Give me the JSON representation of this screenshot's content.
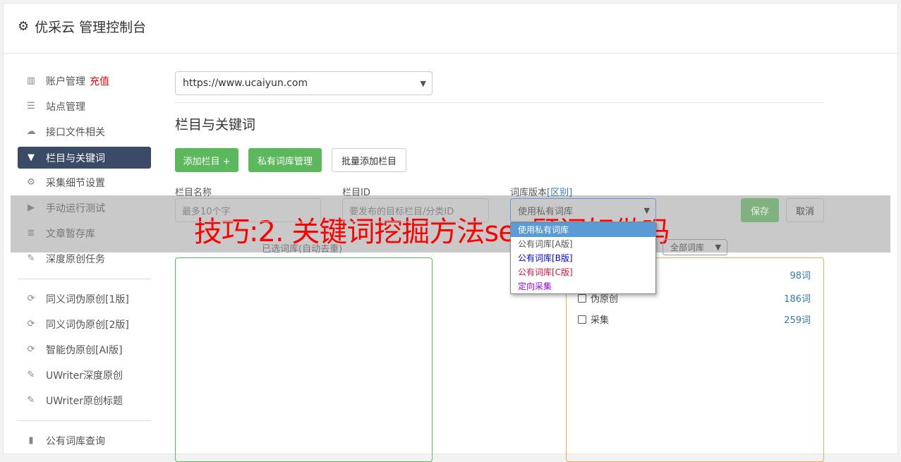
{
  "header": {
    "title": "优采云 管理控制台",
    "icon": "gear-icon"
  },
  "sidebar": {
    "items": [
      {
        "label": "账户管理",
        "badge": "充值",
        "icon": "bar-chart-icon"
      },
      {
        "label": "站点管理",
        "icon": "server-icon"
      },
      {
        "label": "接口文件相关",
        "icon": "cloud-upload-icon"
      },
      {
        "label": "栏目与关键词",
        "icon": "filter-icon",
        "active": true
      },
      {
        "label": "采集细节设置",
        "icon": "gears-icon"
      },
      {
        "label": "手动运行测试",
        "icon": "play-circle-icon"
      },
      {
        "label": "文章暂存库",
        "icon": "database-icon"
      },
      {
        "label": "深度原创任务",
        "icon": "edit-icon"
      },
      {
        "label": "同义词伪原创[1版]",
        "icon": "refresh-icon"
      },
      {
        "label": "同义词伪原创[2版]",
        "icon": "refresh-icon"
      },
      {
        "label": "智能伪原创[AI版]",
        "icon": "refresh-icon"
      },
      {
        "label": "UWriter深度原创",
        "icon": "edit-icon"
      },
      {
        "label": "UWriter原创标题",
        "icon": "edit-icon"
      },
      {
        "label": "公有词库查询",
        "icon": "book-icon"
      }
    ]
  },
  "main": {
    "site_select": "https://www.ucaiyun.com",
    "section_title": "栏目与关键词",
    "buttons": {
      "add": "添加栏目 +",
      "private_lib": "私有词库管理",
      "batch_add": "批量添加栏目",
      "save": "保存",
      "cancel": "取消"
    },
    "form": {
      "name_label": "栏目名称",
      "name_placeholder": "最多10个字",
      "id_label": "栏目ID",
      "id_placeholder": "要发布的目标栏目/分类ID",
      "version_label": "词库版本",
      "version_link": "[区别]",
      "version_value": "使用私有词库",
      "version_options": [
        {
          "label": "使用私有词库",
          "color": "#ffffff"
        },
        {
          "label": "公有词库[A版]",
          "color": "#555555"
        },
        {
          "label": "公有词库[B版]",
          "color": "#0000ff"
        },
        {
          "label": "公有词库[C版]",
          "color": "#dc143c"
        },
        {
          "label": "定向采集",
          "color": "#9900ff"
        }
      ]
    },
    "selected_libs_label": "已选词库(自动去重)",
    "lib_filter": "全部词库",
    "libs": [
      {
        "label": "",
        "count": "98词"
      },
      {
        "label": "伪原创",
        "count": "186词"
      },
      {
        "label": "采集",
        "count": "259词"
      }
    ]
  },
  "overlay_text": "技巧:2. 关键词挖掘方法seo顾问好做吗"
}
